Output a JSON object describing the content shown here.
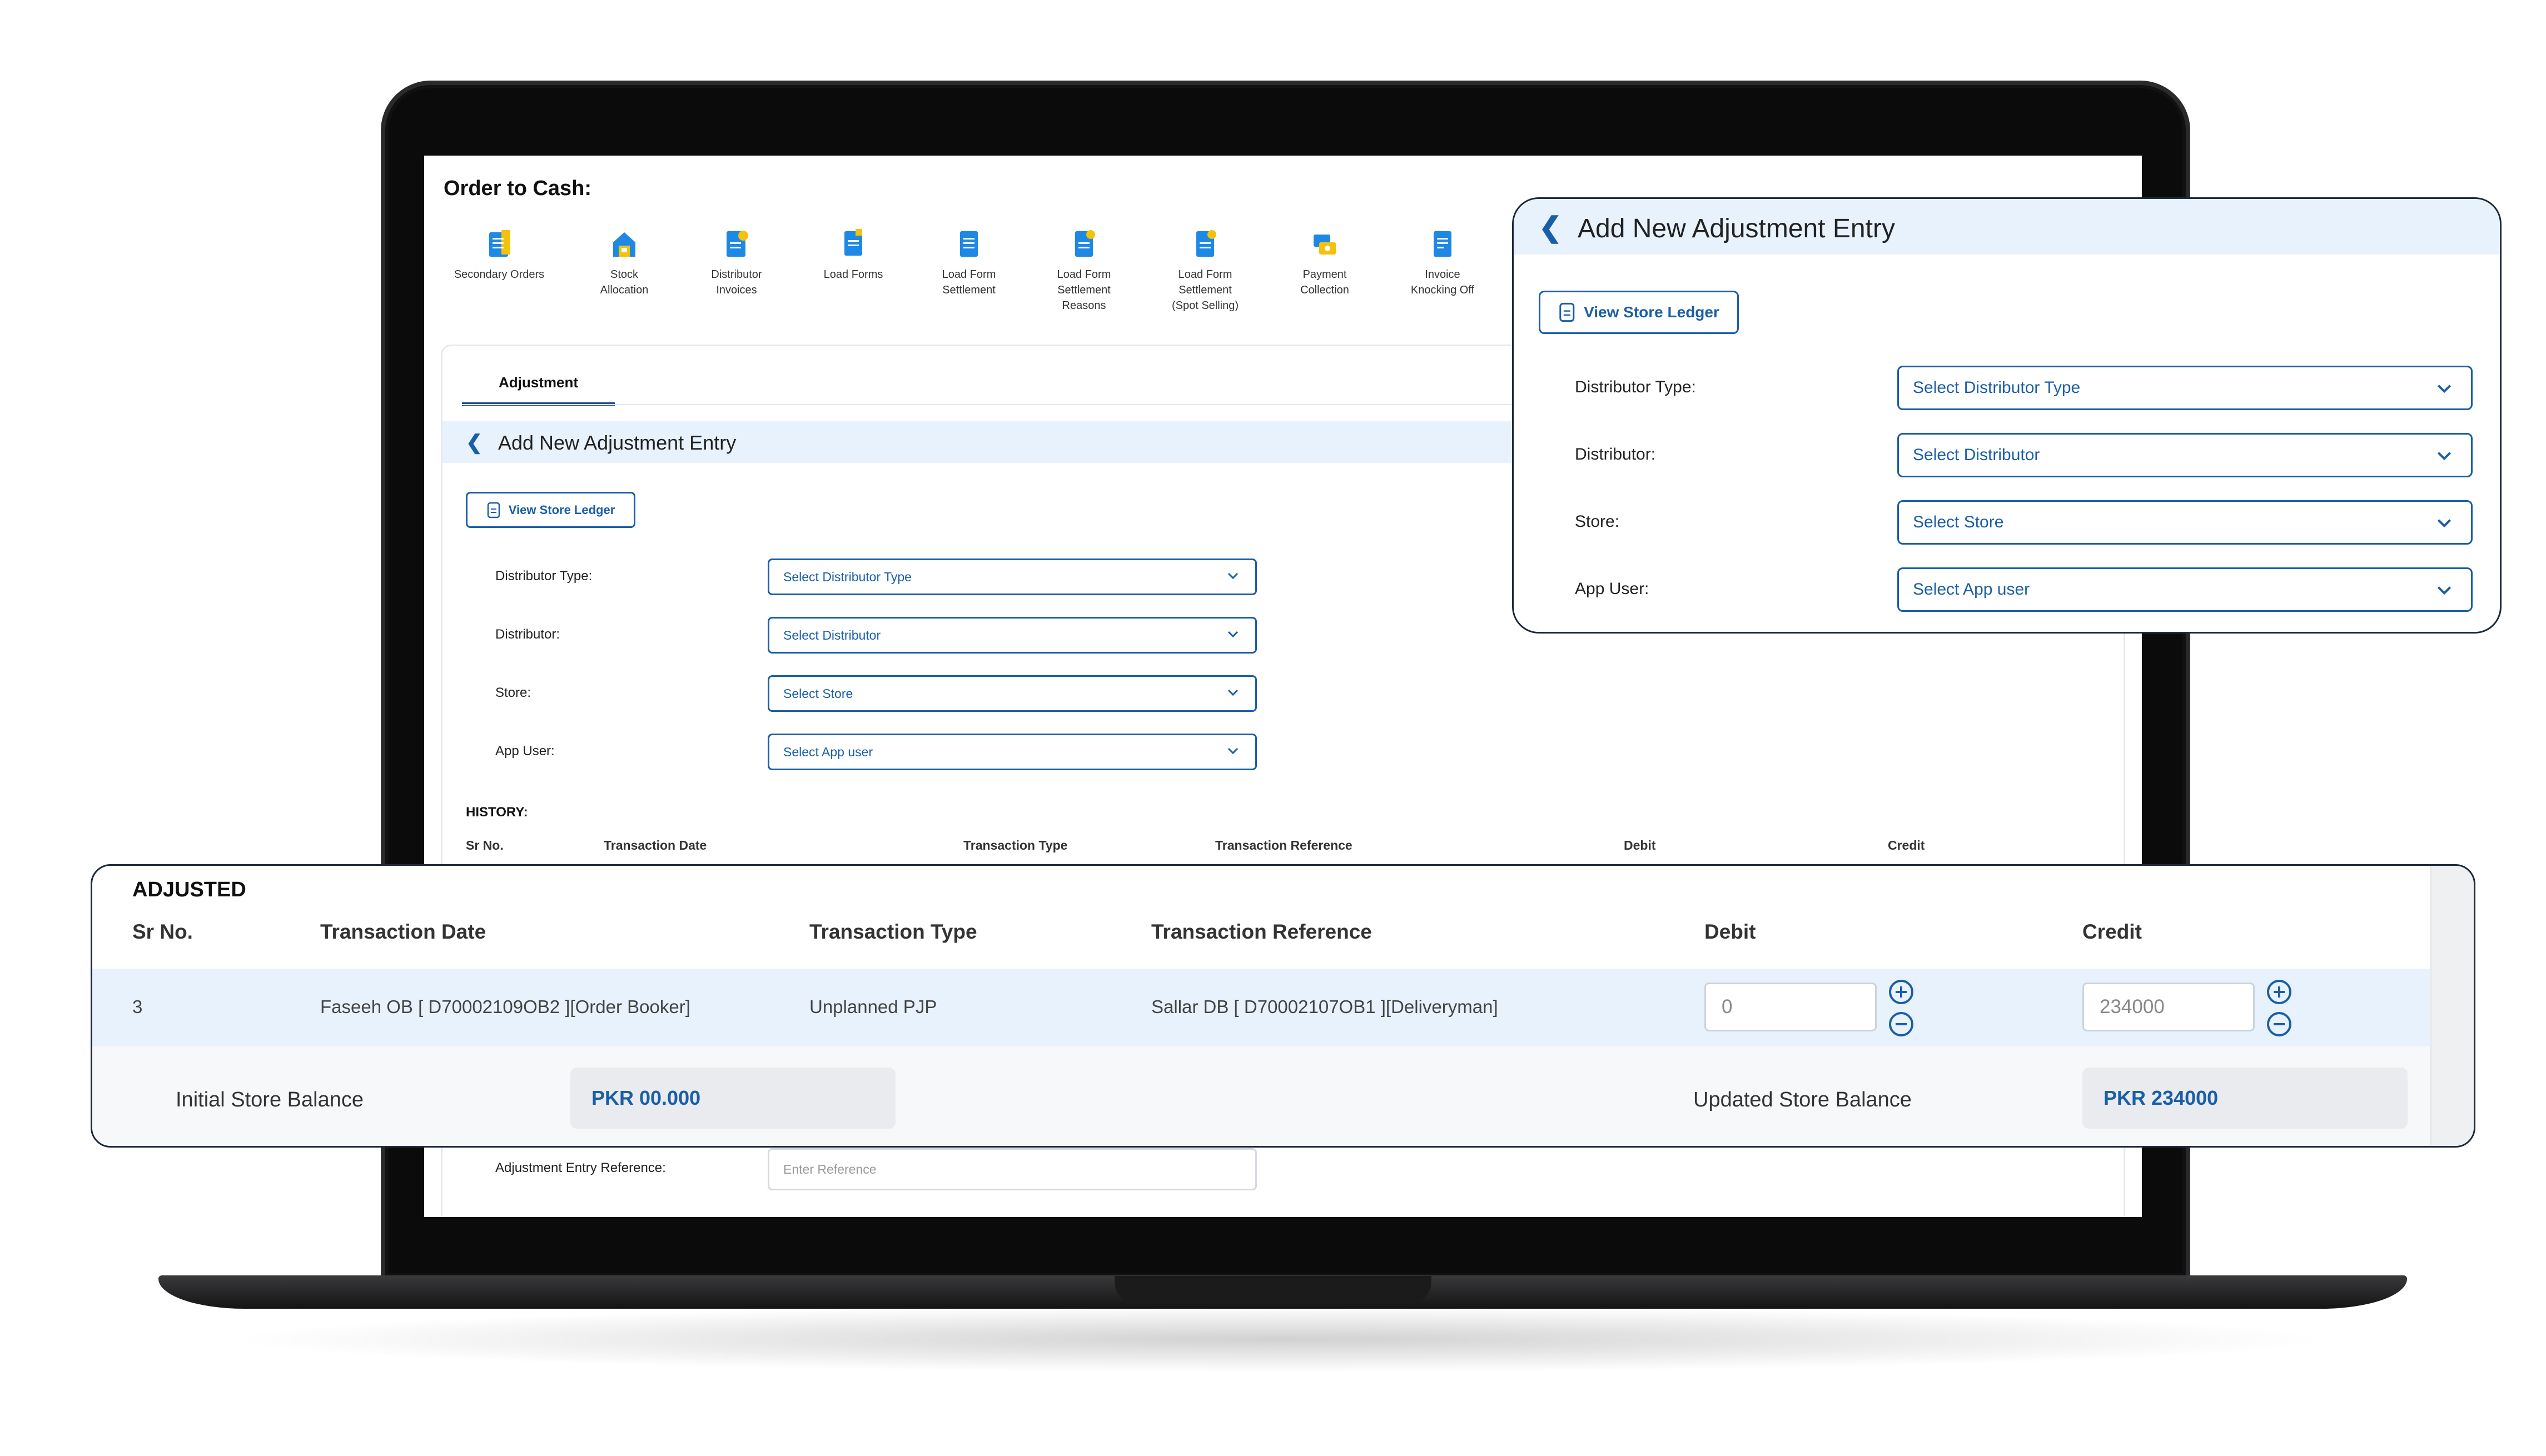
{
  "section_title": "Order to Cash:",
  "modules": [
    {
      "label_lines": [
        "Secondary Orders"
      ],
      "icon": "clipboard-icon"
    },
    {
      "label_lines": [
        "Stock",
        "Allocation"
      ],
      "icon": "warehouse-icon"
    },
    {
      "label_lines": [
        "Distributor",
        "Invoices"
      ],
      "icon": "invoice-icon"
    },
    {
      "label_lines": [
        "Load Forms"
      ],
      "icon": "document-icon"
    },
    {
      "label_lines": [
        "Load Form",
        "Settlement"
      ],
      "icon": "document-icon"
    },
    {
      "label_lines": [
        "Load Form",
        "Settlement",
        "Reasons"
      ],
      "icon": "document-icon"
    },
    {
      "label_lines": [
        "Load Form",
        "Settlement",
        "(Spot Selling)"
      ],
      "icon": "document-icon"
    },
    {
      "label_lines": [
        "Payment",
        "Collection"
      ],
      "icon": "payment-icon"
    },
    {
      "label_lines": [
        "Invoice",
        "Knocking Off"
      ],
      "icon": "document-icon"
    }
  ],
  "tab_label": "Adjustment",
  "entry_title": "Add New Adjustment Entry",
  "ledger_button": "View Store Ledger",
  "form": {
    "distributor_type_label": "Distributor Type:",
    "distributor_type_value": "Select Distributor Type",
    "distributor_label": "Distributor:",
    "distributor_value": "Select Distributor",
    "store_label": "Store:",
    "store_value": "Select Store",
    "app_user_label": "App User:",
    "app_user_value": "Select App user"
  },
  "history_label": "HISTORY:",
  "columns": {
    "sr_no": "Sr No.",
    "date": "Transaction Date",
    "type": "Transaction Type",
    "ref": "Transaction Reference",
    "debit": "Debit",
    "credit": "Credit"
  },
  "reference": {
    "label": "Adjustment Entry Reference:",
    "placeholder": "Enter Reference"
  },
  "adjusted": {
    "title": "ADJUSTED",
    "row": {
      "sr_no": "3",
      "date": "Faseeh OB [ D70002109OB2 ][Order Booker]",
      "type": "Unplanned PJP",
      "ref": "Sallar DB [ D70002107OB1 ][Deliveryman]",
      "debit": "0",
      "credit": "234000"
    },
    "initial_balance_label": "Initial Store Balance",
    "initial_balance_value": "PKR 00.000",
    "updated_balance_label": "Updated Store Balance",
    "updated_balance_value": "PKR 234000"
  },
  "colors": {
    "accent": "#1a5ea8",
    "highlight": "#e8f2fc",
    "icon_blue": "#1e88e5",
    "icon_yellow": "#f4c20d"
  }
}
